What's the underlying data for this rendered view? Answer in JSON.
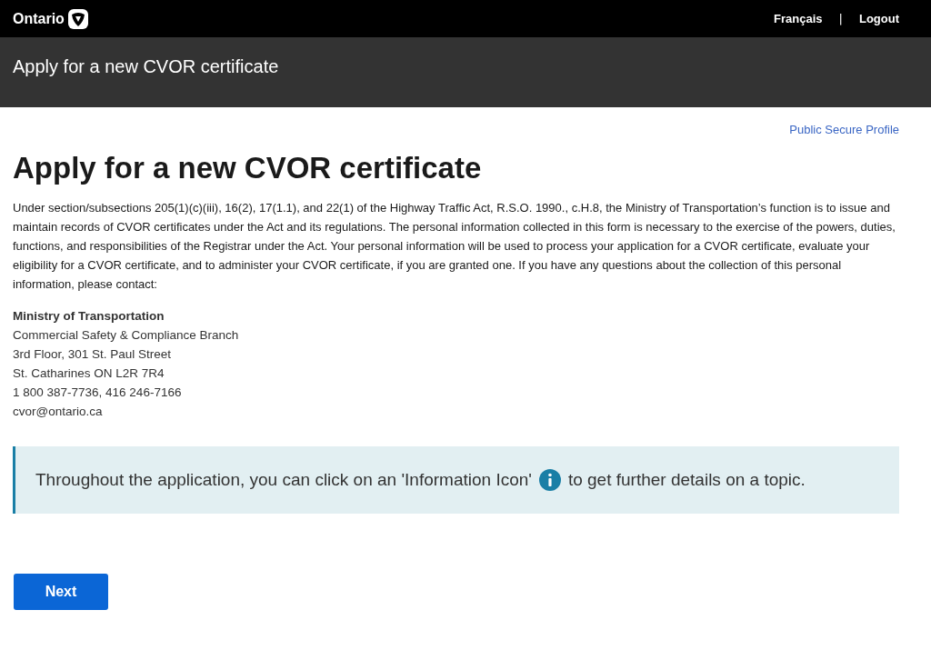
{
  "header": {
    "logo": "Ontario",
    "links": [
      {
        "label": "Français"
      },
      {
        "label": "Logout"
      }
    ],
    "separator": "|"
  },
  "title_bar": {
    "title": "Apply for a new CVOR certificate"
  },
  "profile_link": "Public Secure Profile",
  "heading": "Apply for a new CVOR certificate",
  "intro": "Under section/subsections 205(1)(c)(iii), 16(2), 17(1.1), and 22(1) of the Highway Traffic Act, R.S.O. 1990., c.H.8, the Ministry of Transportation’s function is to issue and maintain records of CVOR certificates under the Act and its regulations. The personal information collected in this form is necessary to the exercise of the powers, duties, functions, and responsibilities of the Registrar under the Act. Your personal information will be used to process your application for a CVOR certificate, evaluate your eligibility for a CVOR certificate, and to administer your CVOR certificate, if you are granted one. If you have any questions about the collection of this personal information, please contact:",
  "contact": {
    "name": "Ministry of Transportation",
    "lines": [
      "Commercial Safety & Compliance Branch",
      "3rd Floor, 301 St. Paul Street",
      "St. Catharines ON L2R 7R4",
      "1 800 387-7736, 416 246-7166",
      "cvor@ontario.ca"
    ]
  },
  "callout": {
    "before": "Throughout the application, you can click on an 'Information Icon'",
    "after": "to get further details on a topic."
  },
  "buttons": [
    {
      "label": "Next"
    }
  ]
}
